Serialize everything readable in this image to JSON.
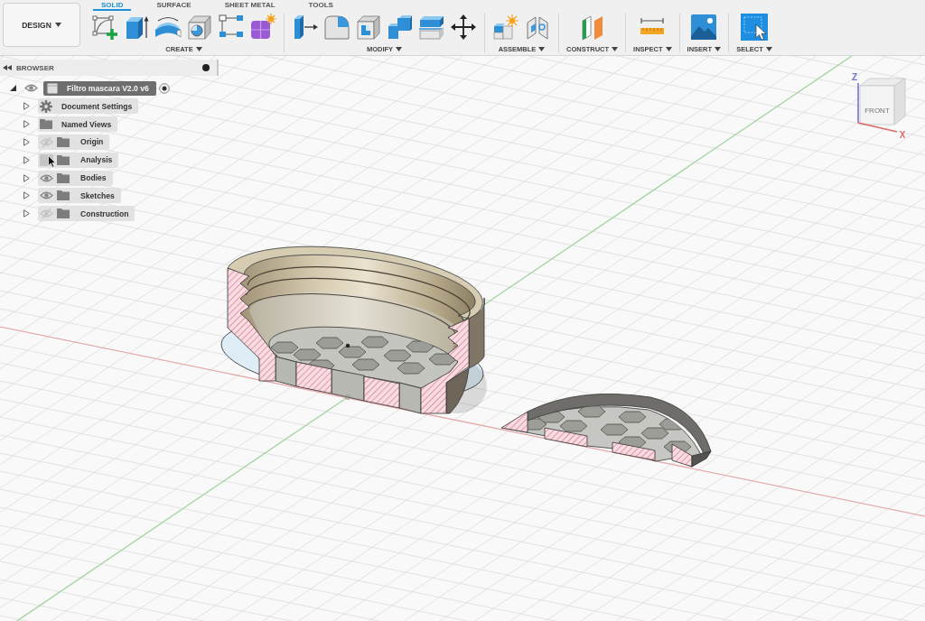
{
  "toolbar": {
    "workspace": {
      "label": "DESIGN"
    },
    "tabs": [
      {
        "label": "SOLID",
        "selected": true
      },
      {
        "label": "SURFACE",
        "selected": false
      },
      {
        "label": "SHEET METAL",
        "selected": false
      },
      {
        "label": "TOOLS",
        "selected": false
      }
    ],
    "groups": [
      {
        "label": "CREATE",
        "tools": [
          {
            "kind": "sketch"
          },
          {
            "kind": "extrude"
          },
          {
            "kind": "revolve"
          },
          {
            "kind": "hole"
          },
          {
            "kind": "pattern"
          },
          {
            "kind": "form"
          }
        ]
      },
      {
        "label": "MODIFY",
        "tools": [
          {
            "kind": "press_pull"
          },
          {
            "kind": "fillet"
          },
          {
            "kind": "shell"
          },
          {
            "kind": "combine"
          },
          {
            "kind": "split"
          },
          {
            "kind": "move"
          }
        ]
      },
      {
        "label": "ASSEMBLE",
        "tools": [
          {
            "kind": "component"
          },
          {
            "kind": "joint"
          }
        ]
      },
      {
        "label": "CONSTRUCT",
        "tools": [
          {
            "kind": "plane"
          }
        ]
      },
      {
        "label": "INSPECT",
        "tools": [
          {
            "kind": "measure"
          }
        ]
      },
      {
        "label": "INSERT",
        "tools": [
          {
            "kind": "image"
          }
        ]
      },
      {
        "label": "SELECT",
        "tools": [
          {
            "kind": "select"
          }
        ]
      }
    ]
  },
  "browser": {
    "title": "BROWSER",
    "root": {
      "label": "Filtro mascara V2.0 v6",
      "expanded": true,
      "visible": true,
      "active": true,
      "children": [
        {
          "label": "Document Settings",
          "kind": "settings",
          "expanded": false
        },
        {
          "label": "Named Views",
          "kind": "views",
          "expanded": false
        },
        {
          "label": "Origin",
          "kind": "folder",
          "expanded": false,
          "visible": false,
          "hovered": false
        },
        {
          "label": "Analysis",
          "kind": "folder",
          "expanded": false,
          "visible": false,
          "hovered": true
        },
        {
          "label": "Bodies",
          "kind": "folder",
          "expanded": false,
          "visible": true,
          "hovered": false
        },
        {
          "label": "Sketches",
          "kind": "folder",
          "expanded": false,
          "visible": true,
          "hovered": false
        },
        {
          "label": "Construction",
          "kind": "folder",
          "expanded": false,
          "visible": false,
          "hovered": false
        }
      ]
    }
  },
  "view_cube": {
    "face": "FRONT",
    "axes": [
      {
        "label": "Z",
        "kind": "z",
        "color": "#7373d6"
      },
      {
        "label": "X",
        "kind": "x",
        "color": "#e06a6a"
      }
    ]
  }
}
